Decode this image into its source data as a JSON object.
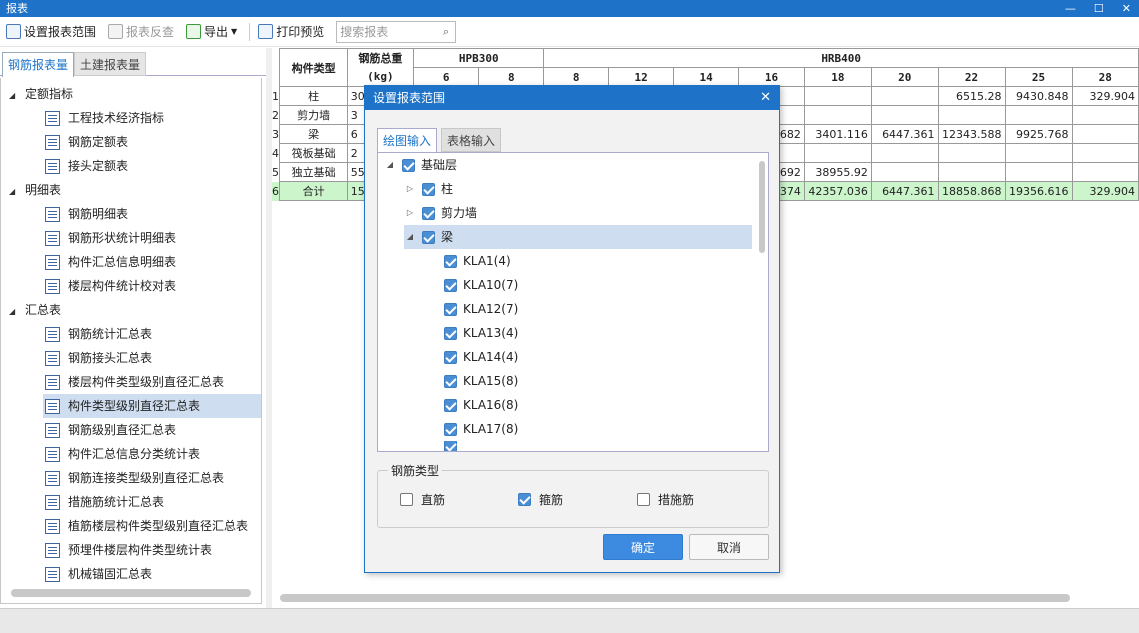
{
  "window": {
    "title": "报表",
    "min_icon": "minimize-icon",
    "max_icon": "maximize-icon",
    "close_icon": "close-icon"
  },
  "toolbar": {
    "set_range": "设置报表范围",
    "reverse_check": "报表反查",
    "export": "导出",
    "print_preview": "打印预览",
    "search_placeholder": "搜索报表"
  },
  "left_tabs": {
    "rebar": "钢筋报表量",
    "civil": "土建报表量"
  },
  "tree": {
    "group1": "定额指标",
    "g1_items": [
      "工程技术经济指标",
      "钢筋定额表",
      "接头定额表"
    ],
    "group2": "明细表",
    "g2_items": [
      "钢筋明细表",
      "钢筋形状统计明细表",
      "构件汇总信息明细表",
      "楼层构件统计校对表"
    ],
    "group3": "汇总表",
    "g3_items": [
      "钢筋统计汇总表",
      "钢筋接头汇总表",
      "楼层构件类型级别直径汇总表",
      "构件类型级别直径汇总表",
      "钢筋级别直径汇总表",
      "构件汇总信息分类统计表",
      "钢筋连接类型级别直径汇总表",
      "措施筋统计汇总表",
      "植筋楼层构件类型级别直径汇总表",
      "预埋件楼层构件类型统计表",
      "机械锚固汇总表"
    ]
  },
  "report": {
    "col_type": "构件类型",
    "col_total": "钢筋总重",
    "col_unit": "(kg)",
    "grade1": "HPB300",
    "grade2": "HRB400",
    "diam1": [
      "6",
      "8"
    ],
    "diam2": [
      "8",
      "12",
      "14",
      "16",
      "18",
      "20",
      "22",
      "25",
      "28"
    ],
    "rows": [
      {
        "n": "1",
        "type": "柱",
        "total": "305",
        "c": [
          "",
          "",
          "",
          "",
          "",
          "",
          "",
          "",
          "6515.28",
          "9430.848",
          "329.904"
        ]
      },
      {
        "n": "2",
        "type": "剪力墙",
        "total": "3",
        "c": [
          "",
          "",
          "",
          "",
          "",
          "",
          "",
          "",
          "",
          "",
          ""
        ]
      },
      {
        "n": "3",
        "type": "梁",
        "total": "6",
        "c": [
          "",
          "",
          "",
          "",
          "",
          "2.682",
          "3401.116",
          "6447.361",
          "12343.588",
          "9925.768",
          ""
        ]
      },
      {
        "n": "4",
        "type": "筏板基础",
        "total": "2",
        "c": [
          "",
          "",
          "",
          "",
          "",
          "",
          "",
          "",
          "",
          "",
          ""
        ]
      },
      {
        "n": "5",
        "type": "独立基础",
        "total": "552",
        "c": [
          "",
          "",
          "",
          "",
          "",
          "9.692",
          "38955.92",
          "",
          "",
          "",
          ""
        ]
      },
      {
        "n": "6",
        "type": "合计",
        "total": "158",
        "c": [
          "",
          "",
          "",
          "",
          "",
          "6.374",
          "42357.036",
          "6447.361",
          "18858.868",
          "19356.616",
          "329.904"
        ]
      }
    ]
  },
  "dialog": {
    "title": "设置报表范围",
    "tab_draw": "绘图输入",
    "tab_table": "表格输入",
    "root": "基础层",
    "nodes": [
      "柱",
      "剪力墙",
      "梁"
    ],
    "beams": [
      "KLA1(4)",
      "KLA10(7)",
      "KLA12(7)",
      "KLA13(4)",
      "KLA14(4)",
      "KLA15(8)",
      "KLA16(8)",
      "KLA17(8)"
    ],
    "rebar_type_label": "钢筋类型",
    "opt_straight": "直筋",
    "opt_stirrup": "箍筋",
    "opt_measure": "措施筋",
    "ok": "确定",
    "cancel": "取消"
  }
}
